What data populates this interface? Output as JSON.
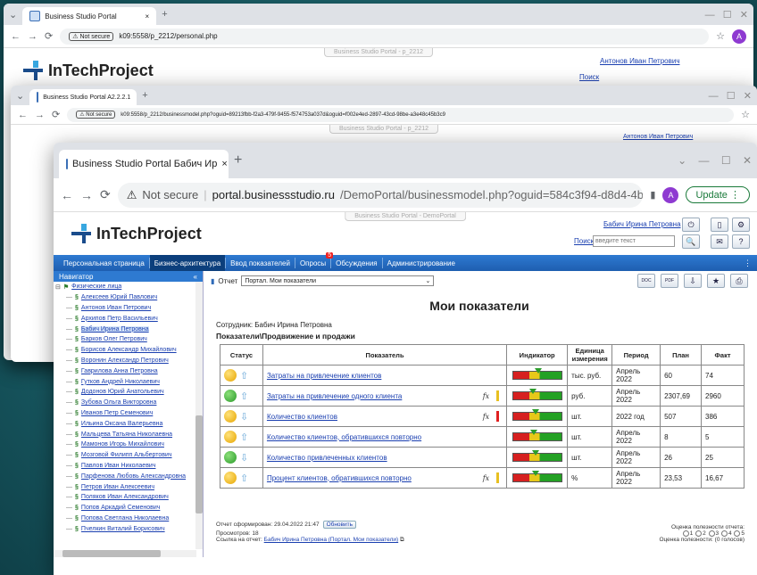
{
  "win1": {
    "tab_title": "Business Studio Portal",
    "url_secure": "Not secure",
    "url": "k09:5558/p_2212/personal.php",
    "banner": "Business Studio Portal - p_2212",
    "logo": "InTechProject",
    "user": "Антонов Иван Петрович",
    "search_link": "Поиск",
    "search_placeholder": "введите текст"
  },
  "win2": {
    "tab_title": "Business Studio Portal A2.2.2.1",
    "url_secure": "Not secure",
    "url": "k09:5558/p_2212/businessmodel.php?oguid=89213fbb-f2a3-479f-9455-f574753a037d&oguid=f002e4ed-2897-43cd-98be-a3e48c45b3c9",
    "banner": "Business Studio Portal - p_2212",
    "logo": "InTechProject",
    "user": "Антонов Иван Петрович"
  },
  "win3": {
    "tab_title": "Business Studio Portal Бабич Ир",
    "url_secure": "Not secure",
    "url_host": "portal.businessstudio.ru",
    "url_path": "/DemoPortal/businessmodel.php?oguid=584c3f94-d8d4-4b6c...",
    "update_label": "Update",
    "avatar_letter": "A",
    "banner": "Business Studio Portal - DemoPortal",
    "logo": "InTechProject",
    "user": "Бабич Ирина Петровна",
    "search_link": "Поиск",
    "search_placeholder": "введите текст",
    "nav": [
      "Персональная страница",
      "Бизнес-архитектура",
      "Ввод показателей",
      "Опросы",
      "Обсуждения",
      "Администрирование"
    ],
    "nav_badge": "5",
    "navigator": {
      "title": "Навигатор",
      "root": "Физические лица",
      "people": [
        "Алексеев Юрий Павлович",
        "Антонов Иван Петрович",
        "Архипов Петр Васильевич",
        "Бабич Ирина Петровна",
        "Барков Олег Петрович",
        "Борисов Александр Михайлович",
        "Воронин Александр Петрович",
        "Гаврилова Анна Петровна",
        "Гутков Андрей Николаевич",
        "Додонов Юрий Анатольевич",
        "Зубова Ольга Викторовна",
        "Иванов Петр Семенович",
        "Ильина Оксана Валерьевна",
        "Мальцева Татьяна Николаевна",
        "Мамонов Игорь Михайлович",
        "Мозговой Филипп Альбертович",
        "Павлов Иван Николаевич",
        "Парфенова Любовь Александровна",
        "Петров Иван Алексеевич",
        "Поляков Иван Александрович",
        "Попов Аркадий Семенович",
        "Попова Светлана Николаевна",
        "Пчелкин Виталий Борисович"
      ]
    },
    "report": {
      "label": "Отчет",
      "selected": "Портал. Мои показатели",
      "export_doc": "DOC",
      "export_pdf": "PDF"
    },
    "title": "Мои показатели",
    "employee_label": "Сотрудник: Бабич Ирина Петровна",
    "section": "Показатели\\Продвижение и продажи",
    "columns": [
      "Статус",
      "Показатель",
      "Индикатор",
      "Единица измерения",
      "Период",
      "План",
      "Факт"
    ],
    "rows": [
      {
        "status": "yellow",
        "trend": "up",
        "name": "Затраты на привлечение клиентов",
        "fx": "",
        "warn": "",
        "unit": "тыс. руб.",
        "period": "Апрель 2022",
        "plan": "60",
        "fact": "74",
        "marker": 0.5
      },
      {
        "status": "green",
        "trend": "up",
        "name": "Затраты на привлечение одного клиента",
        "fx": "fx",
        "warn": "yellow",
        "unit": "руб.",
        "period": "Апрель 2022",
        "plan": "2307,69",
        "fact": "2960",
        "marker": 0.4
      },
      {
        "status": "yellow",
        "trend": "down",
        "name": "Количество клиентов",
        "fx": "fx",
        "warn": "red",
        "unit": "шт.",
        "period": "2022 год",
        "plan": "507",
        "fact": "386",
        "marker": 0.45
      },
      {
        "status": "yellow",
        "trend": "up",
        "name": "Количество клиентов, обратившихся повторно",
        "fx": "",
        "warn": "",
        "unit": "шт.",
        "period": "Апрель 2022",
        "plan": "8",
        "fact": "5",
        "marker": 0.42
      },
      {
        "status": "green",
        "trend": "down",
        "name": "Количество привлеченных клиентов",
        "fx": "",
        "warn": "",
        "unit": "шт.",
        "period": "Апрель 2022",
        "plan": "26",
        "fact": "25",
        "marker": 0.45
      },
      {
        "status": "yellow",
        "trend": "up",
        "name": "Процент клиентов, обратившихся повторно",
        "fx": "fx",
        "warn": "yellow",
        "unit": "%",
        "period": "Апрель 2022",
        "plan": "23,53",
        "fact": "16,67",
        "marker": 0.45
      }
    ],
    "footer": {
      "generated": "Отчет сформирован: 29.04.2022 21:47",
      "refresh": "Обновить",
      "views": "Просмотров: 18",
      "link_label": "Ссылка на отчет:",
      "link_text": "Бабич Ирина Петровна (Портал. Мои показатели)",
      "rating_label": "Оценка полезности отчета:",
      "rating_options": [
        "1",
        "2",
        "3",
        "4",
        "5"
      ],
      "rating_result": "Оценка полезности: (0 голосов)"
    }
  }
}
